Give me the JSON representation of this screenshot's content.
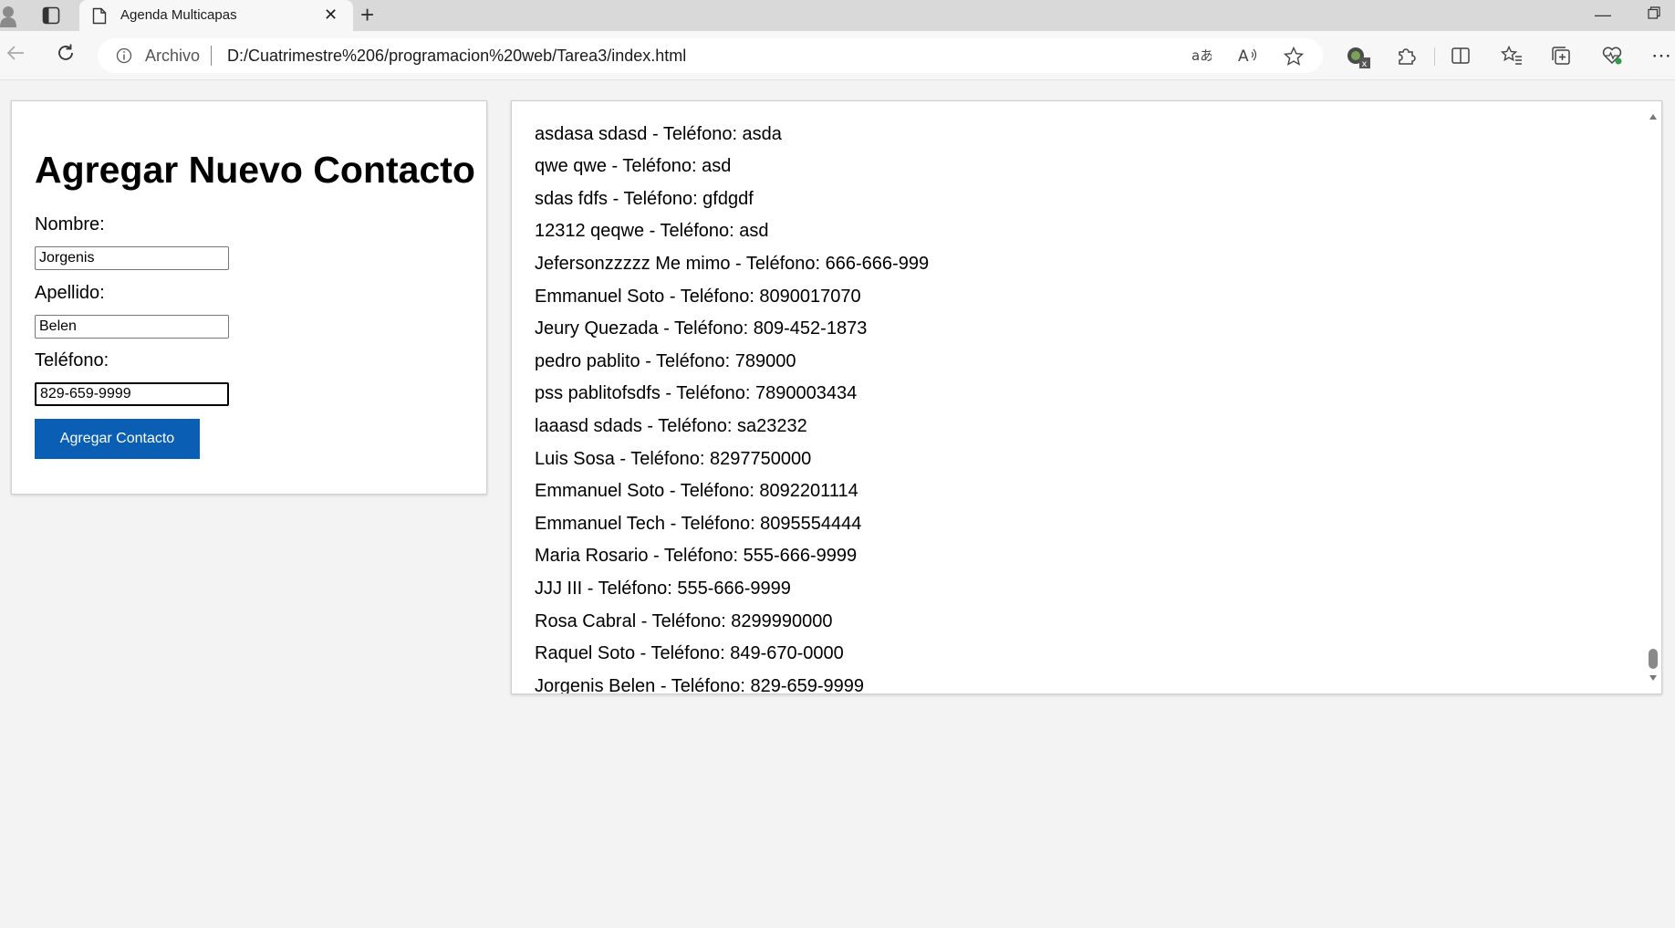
{
  "browser": {
    "tab_title": "Agenda Multicapas",
    "address_label": "Archivo",
    "url": "D:/Cuatrimestre%206/programacion%20web/Tarea3/index.html"
  },
  "form": {
    "heading": "Agregar Nuevo Contacto",
    "nombre_label": "Nombre:",
    "nombre_value": "Jorgenis",
    "apellido_label": "Apellido:",
    "apellido_value": "Belen",
    "telefono_label": "Teléfono:",
    "telefono_value": "829-659-9999",
    "submit_label": "Agregar Contacto"
  },
  "contacts": [
    "asdasa sdasd - Teléfono: asda",
    "qwe qwe - Teléfono: asd",
    "sdas fdfs - Teléfono: gfdgdf",
    "12312 qeqwe - Teléfono: asd",
    "Jefersonzzzzz Me mimo - Teléfono: 666-666-999",
    "Emmanuel Soto - Teléfono: 8090017070",
    "Jeury Quezada - Teléfono: 809-452-1873",
    "pedro pablito - Teléfono: 789000",
    "pss pablitofsdfs - Teléfono: 7890003434",
    "laaasd sdads - Teléfono: sa23232",
    "Luis Sosa - Teléfono: 8297750000",
    "Emmanuel Soto - Teléfono: 8092201114",
    "Emmanuel Tech - Teléfono: 8095554444",
    "Maria Rosario - Teléfono: 555-666-9999",
    "JJJ III - Teléfono: 555-666-9999",
    "Rosa Cabral - Teléfono: 8299990000",
    "Raquel Soto - Teléfono: 849-670-0000",
    "Jorgenis Belen - Teléfono: 829-659-9999"
  ]
}
